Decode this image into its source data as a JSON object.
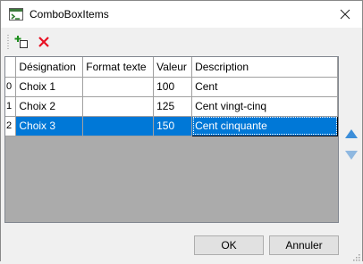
{
  "window": {
    "title": "ComboBoxItems"
  },
  "toolbar": {
    "add_icon": "add-row-icon",
    "delete_icon": "delete-row-icon"
  },
  "grid": {
    "columns": [
      "Désignation",
      "Format texte",
      "Valeur",
      "Description"
    ],
    "rows": [
      {
        "index": "0",
        "designation": "Choix 1",
        "format": "",
        "valeur": "100",
        "description": "Cent"
      },
      {
        "index": "1",
        "designation": "Choix 2",
        "format": "",
        "valeur": "125",
        "description": "Cent vingt-cinq"
      },
      {
        "index": "2",
        "designation": "Choix 3",
        "format": "",
        "valeur": "150",
        "description": "Cent cinquante"
      }
    ],
    "selected_row": 2
  },
  "side_buttons": {
    "up_icon": "arrow-up-icon",
    "down_icon": "arrow-down-icon"
  },
  "footer": {
    "ok_label": "OK",
    "cancel_label": "Annuler"
  },
  "colors": {
    "selection": "#0078d7",
    "delete": "#e81123",
    "arrow": "#3c8ed9"
  }
}
